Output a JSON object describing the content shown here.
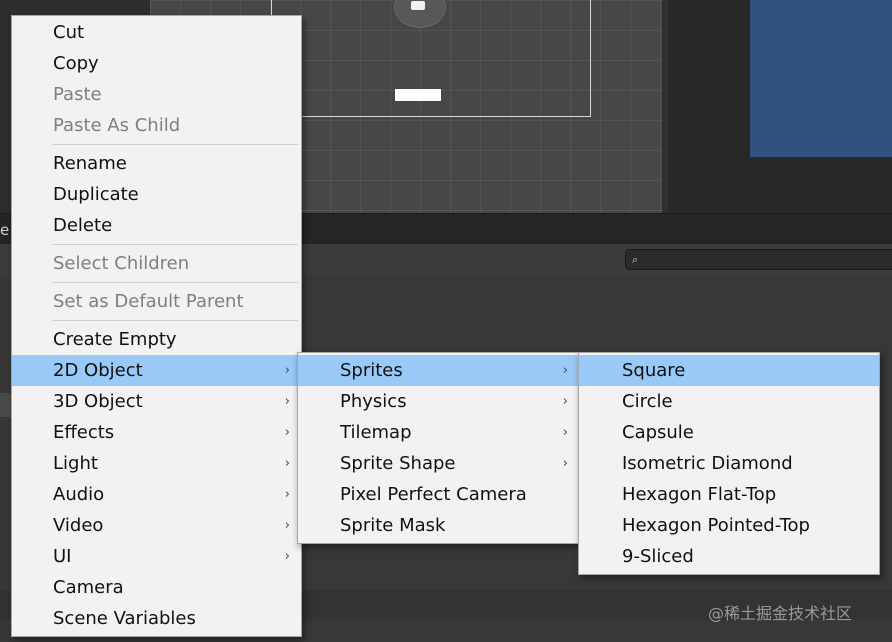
{
  "context_menu": {
    "groups": [
      [
        {
          "label": "Cut",
          "enabled": true
        },
        {
          "label": "Copy",
          "enabled": true
        },
        {
          "label": "Paste",
          "enabled": false
        },
        {
          "label": "Paste As Child",
          "enabled": false
        }
      ],
      [
        {
          "label": "Rename",
          "enabled": true
        },
        {
          "label": "Duplicate",
          "enabled": true
        },
        {
          "label": "Delete",
          "enabled": true
        }
      ],
      [
        {
          "label": "Select Children",
          "enabled": false
        }
      ],
      [
        {
          "label": "Set as Default Parent",
          "enabled": false
        }
      ],
      [
        {
          "label": "Create Empty",
          "enabled": true
        },
        {
          "label": "2D Object",
          "enabled": true,
          "submenu": true,
          "highlighted": true
        },
        {
          "label": "3D Object",
          "enabled": true,
          "submenu": true
        },
        {
          "label": "Effects",
          "enabled": true,
          "submenu": true
        },
        {
          "label": "Light",
          "enabled": true,
          "submenu": true
        },
        {
          "label": "Audio",
          "enabled": true,
          "submenu": true
        },
        {
          "label": "Video",
          "enabled": true,
          "submenu": true
        },
        {
          "label": "UI",
          "enabled": true,
          "submenu": true
        },
        {
          "label": "Camera",
          "enabled": true
        },
        {
          "label": "Scene Variables",
          "enabled": true
        }
      ]
    ]
  },
  "object_2d_menu": {
    "items": [
      {
        "label": "Sprites",
        "submenu": true,
        "highlighted": true
      },
      {
        "label": "Physics",
        "submenu": true
      },
      {
        "label": "Tilemap",
        "submenu": true
      },
      {
        "label": "Sprite Shape",
        "submenu": true
      },
      {
        "label": "Pixel Perfect Camera",
        "submenu": false
      },
      {
        "label": "Sprite Mask",
        "submenu": false
      }
    ]
  },
  "sprites_menu": {
    "items": [
      {
        "label": "Square",
        "highlighted": true
      },
      {
        "label": "Circle"
      },
      {
        "label": "Capsule"
      },
      {
        "label": "Isometric Diamond"
      },
      {
        "label": "Hexagon Flat-Top"
      },
      {
        "label": "Hexagon Pointed-Top"
      },
      {
        "label": "9-Sliced"
      }
    ]
  },
  "background": {
    "partial_tab_text": "e",
    "search_icon": "⌕",
    "watermark": "@稀土掘金技术社区"
  },
  "icons": {
    "submenu_arrow": "›",
    "search": "magnifier-icon",
    "camera": "camera-icon"
  },
  "colors": {
    "menu_background": "#f2f2f2",
    "highlight": "#99c9f7",
    "disabled_text": "#7f7f7f",
    "preview_blue": "#31517f"
  }
}
